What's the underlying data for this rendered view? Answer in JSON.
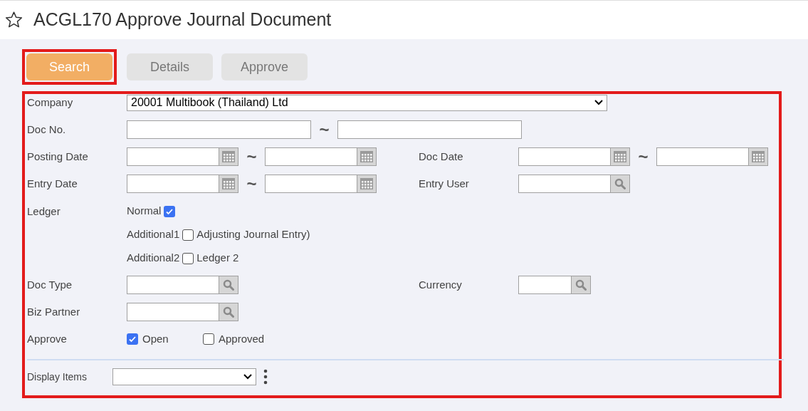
{
  "title": "ACGL170 Approve Journal Document",
  "favorite": false,
  "buttons": [
    {
      "label": "Search",
      "selected": true,
      "highlighted": true
    },
    {
      "label": "Details",
      "selected": false,
      "highlighted": false
    },
    {
      "label": "Approve",
      "selected": false,
      "highlighted": false
    }
  ],
  "form": {
    "highlighted": true,
    "rows": [
      {
        "kind": "select",
        "label": "Company",
        "value": "20001 Multibook (Thailand) Ltd"
      },
      {
        "kind": "fields",
        "cells": [
          {
            "label": "Doc No.",
            "kind": "text",
            "separator": "~"
          }
        ]
      },
      {
        "kind": "fields",
        "cells": [
          {
            "label": "Posting Date",
            "kind": "date",
            "separator": "~"
          },
          {
            "label": "Doc Date",
            "kind": "date",
            "separator": "~"
          }
        ]
      },
      {
        "kind": "fields",
        "cells": [
          {
            "label": "Entry Date",
            "kind": "date",
            "separator": "~"
          },
          {
            "label": "Entry User",
            "kind": "lookup"
          }
        ]
      },
      {
        "kind": "ledger",
        "label": "Ledger",
        "options": [
          {
            "prefix": "Normal",
            "checked": true
          },
          {
            "prefix": "Additional1",
            "checked": false,
            "text": "Adjusting Journal Entry)"
          },
          {
            "prefix": "Additional2",
            "checked": false,
            "text": "Ledger 2"
          }
        ]
      },
      {
        "kind": "fields",
        "cells": [
          {
            "label": "Doc Type",
            "kind": "lookup"
          },
          {
            "label": "Currency",
            "kind": "short_lookup"
          }
        ]
      },
      {
        "kind": "fields",
        "cells": [
          {
            "label": "Biz Partner",
            "kind": "lookup"
          }
        ]
      },
      {
        "kind": "approve",
        "label": "Approve",
        "options": [
          {
            "text": "Open",
            "checked": true
          },
          {
            "text": "Approved",
            "checked": false
          }
        ]
      }
    ],
    "display_items": {
      "label": "Display Items"
    }
  }
}
